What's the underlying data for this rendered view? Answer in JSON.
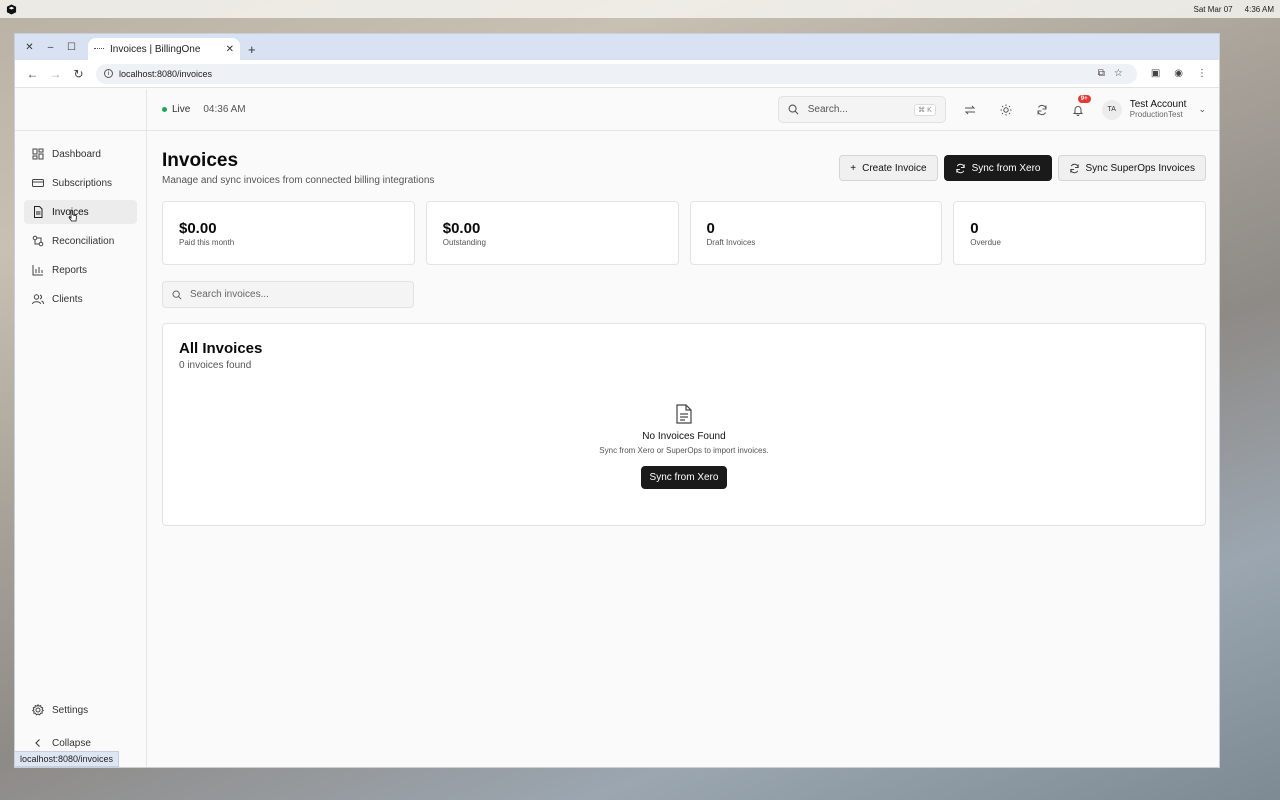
{
  "os": {
    "date": "Sat Mar 07",
    "time": "4:36 AM"
  },
  "browser": {
    "tab_title": "Invoices | BillingOne",
    "new_tab": "+",
    "url": "localhost:8080/invoices",
    "status_url": "localhost:8080/invoices"
  },
  "sidebar": {
    "items": [
      {
        "label": "Dashboard",
        "icon": "dashboard-icon"
      },
      {
        "label": "Subscriptions",
        "icon": "card-icon"
      },
      {
        "label": "Invoices",
        "icon": "document-icon"
      },
      {
        "label": "Reconciliation",
        "icon": "reconcile-icon"
      },
      {
        "label": "Reports",
        "icon": "bar-chart-icon"
      },
      {
        "label": "Clients",
        "icon": "users-icon"
      }
    ],
    "active": "Invoices",
    "settings": "Settings",
    "collapse": "Collapse"
  },
  "topbar": {
    "live_label": "Live",
    "live_color": "#22a35a",
    "live_time": "04:36 AM",
    "search_placeholder": "Search...",
    "search_shortcut": "⌘ K",
    "notif_badge": "9+",
    "avatar_initials": "TA",
    "account_name": "Test Account",
    "account_org": "ProductionTest"
  },
  "page": {
    "title": "Invoices",
    "subtitle": "Manage and sync invoices from connected billing integrations",
    "buttons": {
      "create": "Create Invoice",
      "sync_xero": "Sync from Xero",
      "sync_superops": "Sync SuperOps Invoices"
    }
  },
  "stats": [
    {
      "value": "$0.00",
      "label": "Paid this month"
    },
    {
      "value": "$0.00",
      "label": "Outstanding"
    },
    {
      "value": "0",
      "label": "Draft Invoices"
    },
    {
      "value": "0",
      "label": "Overdue"
    }
  ],
  "search_invoices_placeholder": "Search invoices...",
  "panel": {
    "title": "All Invoices",
    "count": "0 invoices found",
    "empty_title": "No Invoices Found",
    "empty_sub": "Sync from Xero or SuperOps to import invoices.",
    "empty_button": "Sync from Xero"
  }
}
